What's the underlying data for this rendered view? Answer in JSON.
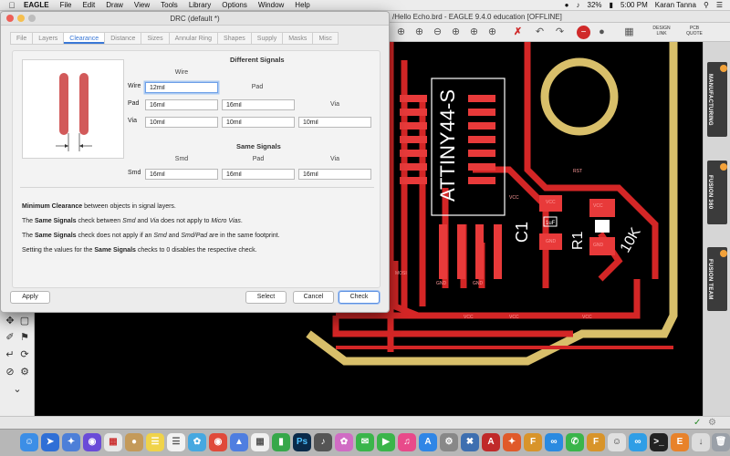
{
  "menubar": {
    "app_name": "EAGLE",
    "items": [
      "File",
      "Edit",
      "Draw",
      "View",
      "Tools",
      "Library",
      "Options",
      "Window",
      "Help"
    ],
    "battery": "32%",
    "time": "5:00 PM",
    "user": "Karan Tanna"
  },
  "eagle_window": {
    "title": "/Hello Echo.brd - EAGLE 9.4.0 education [OFFLINE]",
    "toolbar_labels": {
      "design_link": "DESIGN LINK",
      "pcb_quote": "PCB QUOTE"
    }
  },
  "right_tabs": [
    "MANUFACTURING",
    "FUSION 360",
    "FUSION TEAM"
  ],
  "board": {
    "chip_label": "ATTINY44-S",
    "parts": [
      "C1",
      "R1",
      "10K",
      "1uF"
    ],
    "pad_labels": [
      "VCC",
      "GND",
      "RST",
      "VCC",
      "GND",
      "VCC",
      "VCC",
      "GND",
      "GND",
      "VCC",
      "VCC",
      "MOSI"
    ]
  },
  "drc_dialog": {
    "title": "DRC (default *)",
    "tabs": [
      "File",
      "Layers",
      "Clearance",
      "Distance",
      "Sizes",
      "Annular Ring",
      "Shapes",
      "Supply",
      "Masks",
      "Misc"
    ],
    "active_tab": "Clearance",
    "different_signals": {
      "title": "Different Signals",
      "wire_head": "Wire",
      "pad_head": "Pad",
      "via_head": "Via",
      "rows": [
        {
          "label": "Wire",
          "values": [
            "12mil"
          ]
        },
        {
          "label": "Pad",
          "values": [
            "16mil",
            "16mil"
          ]
        },
        {
          "label": "Via",
          "values": [
            "10mil",
            "10mil",
            "10mil"
          ]
        }
      ]
    },
    "same_signals": {
      "title": "Same Signals",
      "heads": [
        "Smd",
        "Pad",
        "Via"
      ],
      "row": {
        "label": "Smd",
        "values": [
          "16mil",
          "16mil",
          "16mil"
        ]
      }
    },
    "notes": {
      "n1_bold": "Minimum Clearance",
      "n1_rest": " between objects in signal layers.",
      "n2_a": "The ",
      "n2_b": "Same Signals",
      "n2_c": " check between ",
      "n2_d": "Smd",
      "n2_e": " and ",
      "n2_f": "Via",
      "n2_g": " does not apply to ",
      "n2_h": "Micro Vias",
      "n2_i": ".",
      "n3_a": "The ",
      "n3_b": "Same Signals",
      "n3_c": " check does not apply if an ",
      "n3_d": "Smd",
      "n3_e": " and ",
      "n3_f": "Smd/Pad",
      "n3_g": " are in the same footprint.",
      "n4_a": "Setting the values for the ",
      "n4_b": "Same Signals",
      "n4_c": " checks to 0 disables the respective check."
    },
    "buttons": {
      "apply": "Apply",
      "select": "Select",
      "cancel": "Cancel",
      "check": "Check"
    }
  },
  "colors": {
    "trace": "#d42626",
    "outline": "#d8bf6a",
    "accent": "#3a78d6"
  }
}
